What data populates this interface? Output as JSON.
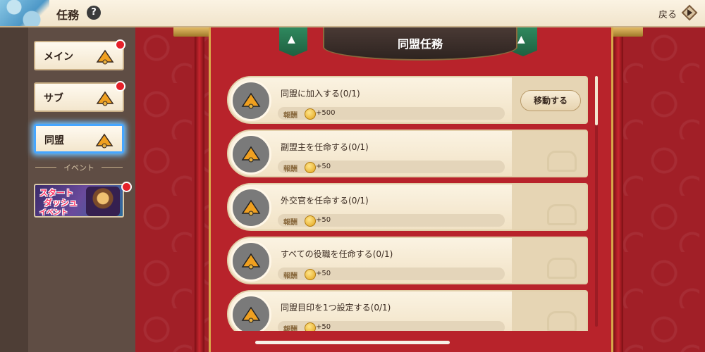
{
  "topbar": {
    "title": "任務",
    "help_label": "?",
    "back_label": "戻る"
  },
  "sidebar": {
    "tabs": [
      {
        "label": "メイン",
        "badge": true
      },
      {
        "label": "サブ",
        "badge": true
      },
      {
        "label": "同盟",
        "badge": false,
        "active": true
      }
    ],
    "event_separator": "イベント",
    "event_banner": {
      "line1": "スタート",
      "line2": "ダッシュ",
      "line3": "イベント",
      "badge": true
    }
  },
  "panel": {
    "title": "同盟任務"
  },
  "tasks": [
    {
      "name": "同盟に加入する",
      "progress": "(0/1)",
      "reward_label": "報酬",
      "reward_amount": "+500",
      "button_label": "移動する"
    },
    {
      "name": "副盟主を任命する",
      "progress": "(0/1)",
      "reward_label": "報酬",
      "reward_amount": "+50"
    },
    {
      "name": "外交官を任命する",
      "progress": "(0/1)",
      "reward_label": "報酬",
      "reward_amount": "+50"
    },
    {
      "name": "すべての役職を任命する",
      "progress": "(0/1)",
      "reward_label": "報酬",
      "reward_amount": "+50"
    },
    {
      "name": "同盟目印を1つ設定する",
      "progress": "(0/1)",
      "reward_label": "報酬",
      "reward_amount": "+50"
    }
  ],
  "colors": {
    "accent_red": "#a11f27",
    "badge_red": "#e5202a",
    "active_tab_glow": "#46a6ff",
    "header_dark": "#2e2420"
  }
}
